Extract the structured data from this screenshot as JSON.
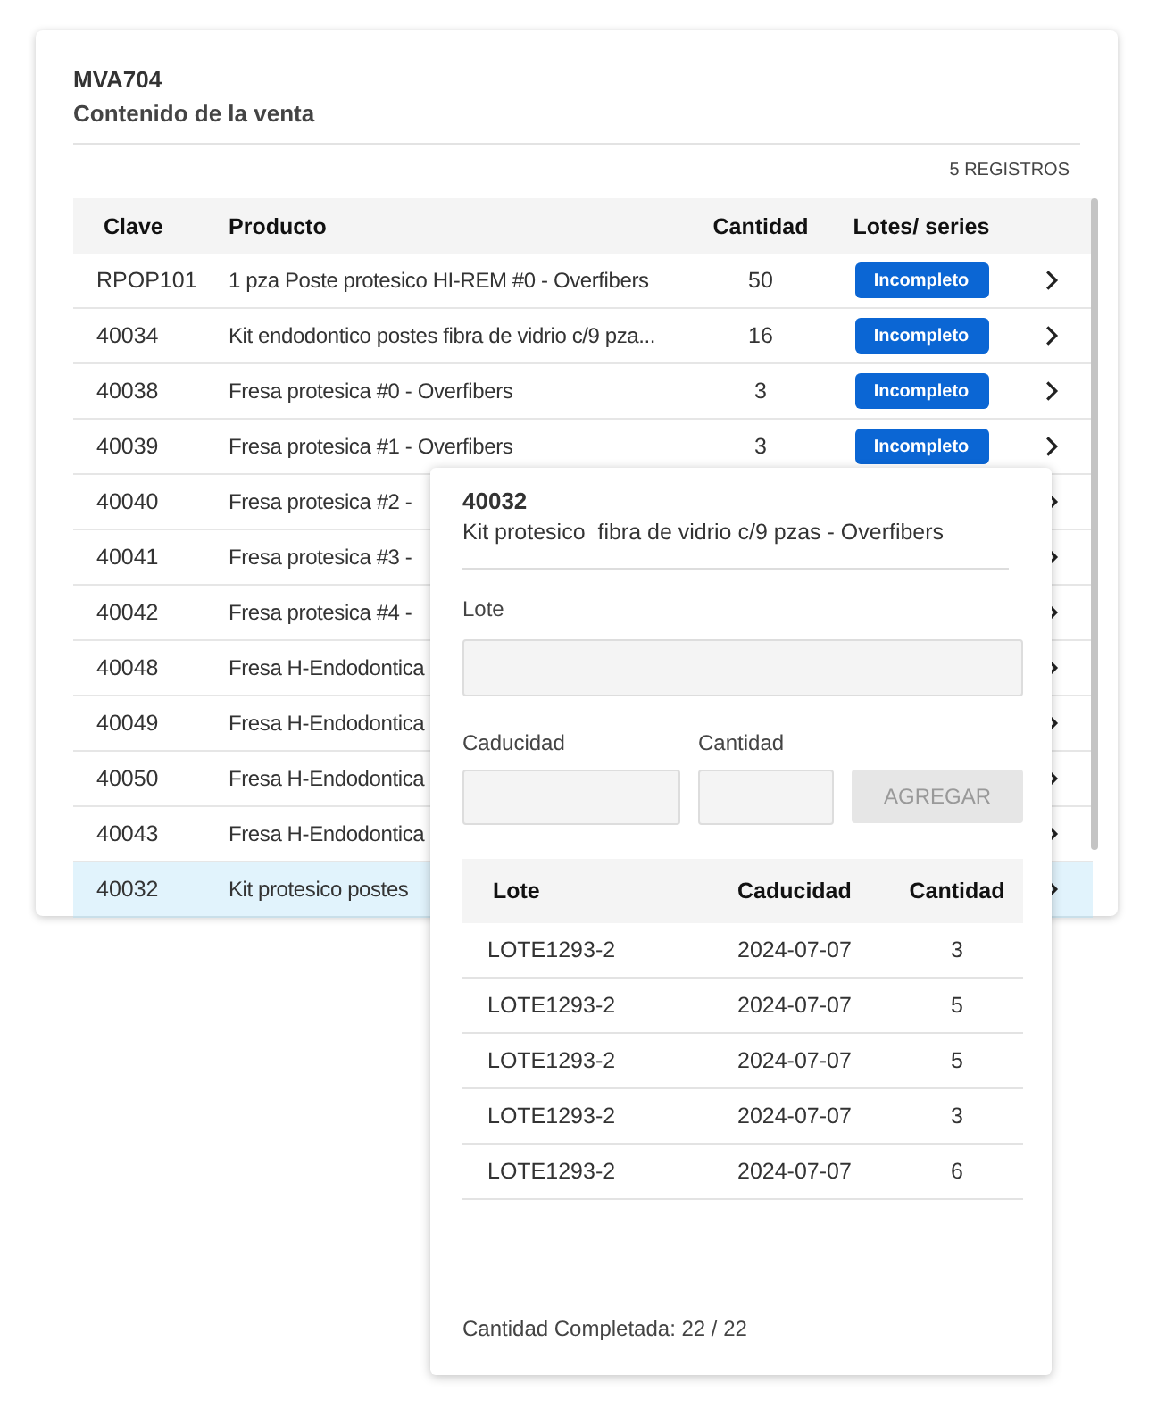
{
  "sale": {
    "code": "MVA704",
    "title": "Contenido de la venta",
    "record_count": "5 REGISTROS"
  },
  "table": {
    "columns": [
      "Clave",
      "Producto",
      "Cantidad",
      "Lotes/ series"
    ],
    "rows": [
      {
        "clave": "RPOP101",
        "producto": "1 pza Poste protesico HI-REM #0 - Overfibers",
        "cantidad": "50",
        "status": "Incompleto",
        "selected": false
      },
      {
        "clave": "40034",
        "producto": "Kit endodontico postes fibra de vidrio c/9 pza...",
        "cantidad": "16",
        "status": "Incompleto",
        "selected": false
      },
      {
        "clave": "40038",
        "producto": "Fresa protesica #0 - Overfibers",
        "cantidad": "3",
        "status": "Incompleto",
        "selected": false
      },
      {
        "clave": "40039",
        "producto": "Fresa protesica #1 - Overfibers",
        "cantidad": "3",
        "status": "Incompleto",
        "selected": false
      },
      {
        "clave": "40040",
        "producto": "Fresa protesica #2 -",
        "selected": false
      },
      {
        "clave": "40041",
        "producto": "Fresa protesica #3 -",
        "selected": false
      },
      {
        "clave": "40042",
        "producto": "Fresa protesica #4 -",
        "selected": false
      },
      {
        "clave": "40048",
        "producto": "Fresa H-Endodontica",
        "selected": false
      },
      {
        "clave": "40049",
        "producto": "Fresa H-Endodontica",
        "selected": false
      },
      {
        "clave": "40050",
        "producto": "Fresa H-Endodontica",
        "selected": false
      },
      {
        "clave": "40043",
        "producto": "Fresa H-Endodontica",
        "selected": false
      },
      {
        "clave": "40032",
        "producto": "Kit protesico postes",
        "selected": true
      }
    ]
  },
  "detail": {
    "code": "40032",
    "product": "Kit protesico  fibra de vidrio c/9 pzas - Overfibers",
    "lote_label": "Lote",
    "caducidad_label": "Caducidad",
    "cantidad_label": "Cantidad",
    "add_button": {
      "label": "AGREGAR",
      "disabled": true
    },
    "lots": {
      "columns": [
        "Lote",
        "Caducidad",
        "Cantidad"
      ],
      "rows": [
        {
          "lote": "LOTE1293-2",
          "caducidad": "2024-07-07",
          "cantidad": "3"
        },
        {
          "lote": "LOTE1293-2",
          "caducidad": "2024-07-07",
          "cantidad": "5"
        },
        {
          "lote": "LOTE1293-2",
          "caducidad": "2024-07-07",
          "cantidad": "5"
        },
        {
          "lote": "LOTE1293-2",
          "caducidad": "2024-07-07",
          "cantidad": "3"
        },
        {
          "lote": "LOTE1293-2",
          "caducidad": "2024-07-07",
          "cantidad": "6"
        }
      ]
    },
    "footer": "Cantidad Completada: 22 / 22"
  }
}
